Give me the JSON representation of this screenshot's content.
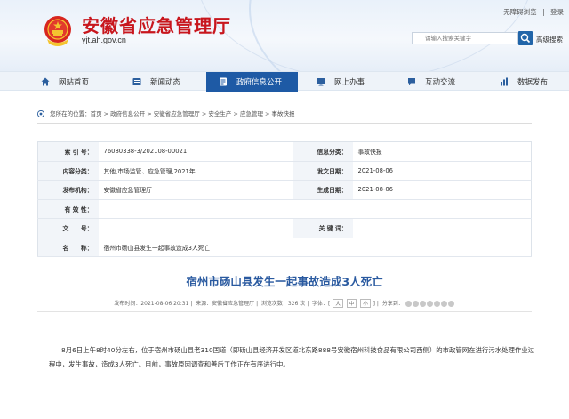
{
  "header": {
    "site_title": "安徽省应急管理厅",
    "site_url": "yjt.ah.gov.cn",
    "top_links": [
      "无障碍浏览",
      "|",
      "登录"
    ],
    "search_placeholder": "请输入搜索关键字",
    "advanced_search": "高级搜索"
  },
  "nav": {
    "items": [
      {
        "label": "网站首页",
        "icon": "home-icon"
      },
      {
        "label": "新闻动态",
        "icon": "news-icon"
      },
      {
        "label": "政府信息公开",
        "icon": "info-icon",
        "active": true
      },
      {
        "label": "网上办事",
        "icon": "monitor-icon"
      },
      {
        "label": "互动交流",
        "icon": "chat-icon"
      },
      {
        "label": "数据发布",
        "icon": "chart-icon"
      }
    ],
    "active_color": "#1e5aa5"
  },
  "breadcrumb": {
    "prefix": "您所在的位置：",
    "items": [
      "首页",
      "政府信息公开",
      "安徽省应急管理厅",
      "安全生产",
      "应急管理",
      "事故快报"
    ],
    "sep": " > "
  },
  "meta": {
    "labels": {
      "index_no": "索 引 号：",
      "info_type": "信息分类：",
      "content": "内容分类：",
      "issue_date": "发文日期：",
      "publisher": "发布机构：",
      "gen_date": "生成日期：",
      "validity": "有 效 性：",
      "doc_no": "文　　号：",
      "keywords": "关 键 词：",
      "name": "名　　称："
    },
    "values": {
      "index_no": "76080338-3/202108-00021",
      "info_type": "事故快报",
      "content": "其他,市场监管、应急管理,2021年",
      "issue_date": "2021-08-06",
      "publisher": "安徽省应急管理厅",
      "gen_date": "2021-08-06",
      "validity": "",
      "doc_no": "",
      "keywords": "",
      "name": "宿州市砀山县发生一起事故造成3人死亡"
    }
  },
  "article": {
    "title": "宿州市砀山县发生一起事故造成3人死亡",
    "info_time": "发布时间：2021-08-06 20:31",
    "info_source": "来源：安徽省应急管理厅",
    "info_views": "浏览次数：326 次",
    "font_label": "字体：[",
    "size_large": "大",
    "size_mid": "中",
    "size_small": "小",
    "font_label_end": "]",
    "share_label": "分享到：",
    "body": "8月6日上午8时40分左右，位于宿州市砀山县老310国道（即砀山县经济开发区道北东路888号安徽宿州科技食品有限公司西侧）的市政管网在进行污水处理作业过程中，发生事故，造成3人死亡。目前，事故原因调查和善后工作正在有序进行中。"
  }
}
